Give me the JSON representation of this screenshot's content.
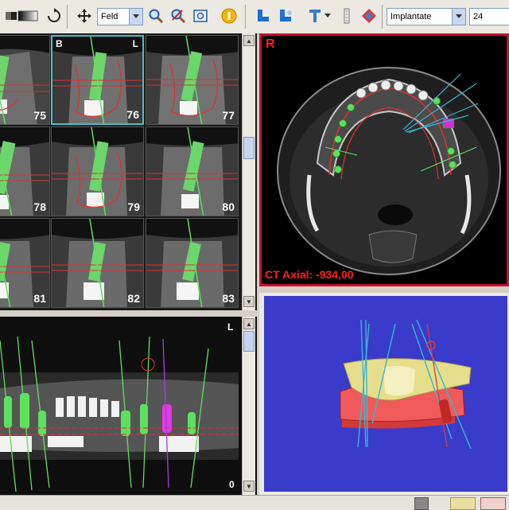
{
  "toolbar": {
    "mode_select": "Feld",
    "object_select": "Implantate",
    "size_select": "24"
  },
  "slices": [
    {
      "number": "75"
    },
    {
      "number": "76",
      "corner_left": "B",
      "corner_right": "L"
    },
    {
      "number": "77"
    },
    {
      "number": "78"
    },
    {
      "number": "79"
    },
    {
      "number": "80"
    },
    {
      "number": "81"
    },
    {
      "number": "82"
    },
    {
      "number": "83"
    }
  ],
  "axial": {
    "corner": "R",
    "readout": "CT Axial: -934,00"
  },
  "panorama": {
    "corner_top": "L",
    "corner_bottom": "0"
  },
  "colors": {
    "viewport_border_active": "#c8102e",
    "selection_border": "#46c2c9",
    "render_background": "#3a3acb",
    "implant": "#5ee05e",
    "implant_selected": "#e03ae0"
  },
  "icons": [
    "window-level-icon",
    "rotate-icon",
    "pan-icon",
    "zoom-in-icon",
    "zoom-out-icon",
    "fit-icon",
    "info-icon",
    "tooth-icon",
    "tooth-alt-icon",
    "implant-tool-icon",
    "ruler-icon",
    "plane-icon"
  ]
}
